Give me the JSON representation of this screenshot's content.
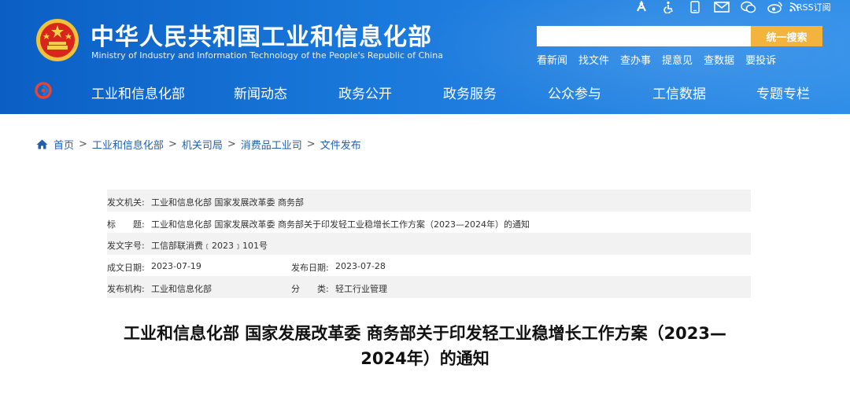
{
  "header": {
    "title_cn": "中华人民共和国工业和信息化部",
    "title_en": "Ministry of Industry and Information Technology of the People's Republic of China",
    "top_icons": [
      "accessibility-icon",
      "wheelchair-icon",
      "mobile-icon",
      "mail-icon",
      "wechat-icon",
      "weibo-icon",
      "rss-icon"
    ],
    "rss_label": "RSS订阅",
    "search": {
      "value": "",
      "button_label": "统一搜索"
    },
    "quicklinks": [
      "看新闻",
      "找文件",
      "查办事",
      "提意见",
      "查数据",
      "要投诉"
    ],
    "colors": {
      "primary": "#1a79dc",
      "search_button": "#f3b33d"
    }
  },
  "nav": {
    "items": [
      "工业和信息化部",
      "新闻动态",
      "政务公开",
      "政务服务",
      "公众参与",
      "工信数据",
      "专题专栏"
    ]
  },
  "breadcrumb": {
    "items": [
      "首页",
      "工业和信息化部",
      "机关司局",
      "消费品工业司",
      "文件发布"
    ],
    "separator": ">"
  },
  "meta": {
    "issuer_label": "发文机关:",
    "issuer": "工业和信息化部 国家发展改革委 商务部",
    "title_label": "标　　题:",
    "title": "工业和信息化部 国家发展改革委 商务部关于印发轻工业稳增长工作方案（2023—2024年）的通知",
    "docno_label": "发文字号:",
    "docno": "工信部联消费﹝2023﹞101号",
    "created_label": "成文日期:",
    "created": "2023-07-19",
    "published_label": "发布日期:",
    "published": "2023-07-28",
    "org_label": "发布机构:",
    "org": "工业和信息化部",
    "category_label": "分　　类:",
    "category": "轻工行业管理"
  },
  "document": {
    "title_line1": "工业和信息化部 国家发展改革委 商务部关于印发轻工业稳增长工作方案（2023—",
    "title_line2": "2024年）的通知"
  }
}
